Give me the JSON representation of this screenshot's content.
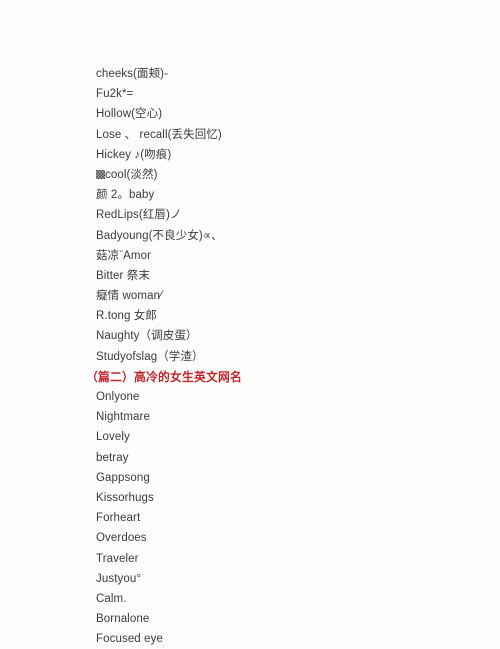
{
  "document": {
    "background_color": "#fdfdfb",
    "text_color": "#3b3b3b",
    "heading_color": "#c0272d"
  },
  "section_one": {
    "names": [
      "cheeks(面颊)-",
      "Fu2k*=",
      "Hollow(空心)",
      "Lose 、 recall(丢失回忆)",
      "Hickey ♪(吻痕)",
      "cool(淡然)",
      "颜 2。baby",
      "RedLips(红唇)ノ",
      "Badyoung(不良少女)∝、",
      "菇凉ˉAmor",
      "Bitter 祭末",
      "癡情 woman⁄",
      "R.tong 女郎",
      "Naughty（调皮蛋）",
      "Studyofslag（学渣）"
    ]
  },
  "heading_two": {
    "label": "（篇二）高冷的女生英文网名"
  },
  "section_two": {
    "names": [
      "Onlyone",
      "Nightmare",
      "Lovely",
      "betray",
      "Gappsong",
      "Kissorhugs",
      "Forheart",
      "Overdoes",
      "Traveler",
      "Justyou°",
      "Calm.",
      "Bornalone",
      "Focused eye"
    ]
  }
}
